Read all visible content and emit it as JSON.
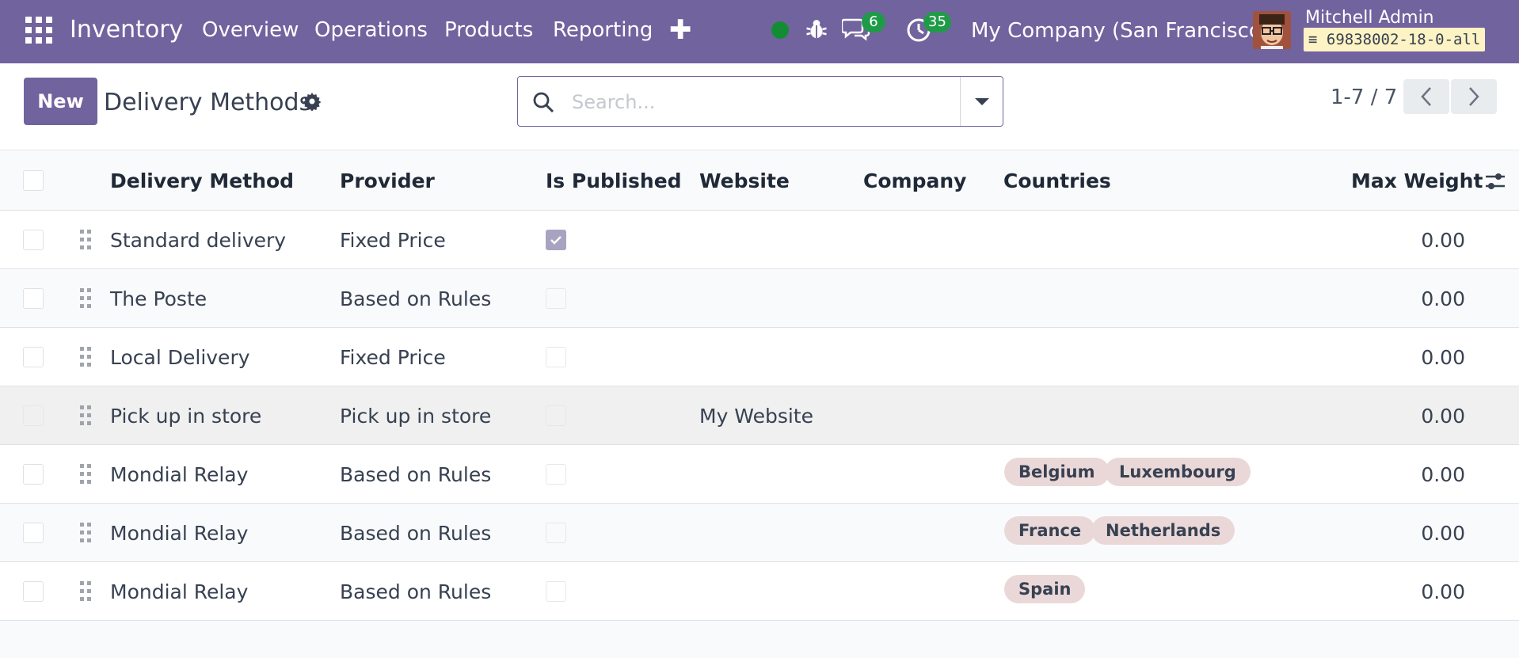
{
  "navbar": {
    "brand": "Inventory",
    "menu": [
      "Overview",
      "Operations",
      "Products",
      "Reporting"
    ],
    "chat_count": "6",
    "activity_count": "35",
    "company": "My Company (San Francisco)",
    "user_name": "Mitchell Admin",
    "db_name": "69838002-18-0-all",
    "brand_color": "#71639e"
  },
  "control": {
    "new_label": "New",
    "title": "Delivery Methods",
    "search_placeholder": "Search...",
    "pager": "1-7 / 7"
  },
  "columns": [
    "Delivery Method",
    "Provider",
    "Is Published",
    "Website",
    "Company",
    "Countries",
    "Max Weight"
  ],
  "rows": [
    {
      "method": "Standard delivery",
      "provider": "Fixed Price",
      "published": true,
      "website": "",
      "company": "",
      "countries": [],
      "max_weight": "0.00"
    },
    {
      "method": "The Poste",
      "provider": "Based on Rules",
      "published": false,
      "website": "",
      "company": "",
      "countries": [],
      "max_weight": "0.00"
    },
    {
      "method": "Local Delivery",
      "provider": "Fixed Price",
      "published": false,
      "website": "",
      "company": "",
      "countries": [],
      "max_weight": "0.00"
    },
    {
      "method": "Pick up in store",
      "provider": "Pick up in store",
      "published": false,
      "website": "My Website",
      "company": "",
      "countries": [],
      "max_weight": "0.00"
    },
    {
      "method": "Mondial Relay",
      "provider": "Based on Rules",
      "published": false,
      "website": "",
      "company": "",
      "countries": [
        "Belgium",
        "Luxembourg"
      ],
      "max_weight": "0.00"
    },
    {
      "method": "Mondial Relay",
      "provider": "Based on Rules",
      "published": false,
      "website": "",
      "company": "",
      "countries": [
        "France",
        "Netherlands"
      ],
      "max_weight": "0.00"
    },
    {
      "method": "Mondial Relay",
      "provider": "Based on Rules",
      "published": false,
      "website": "",
      "company": "",
      "countries": [
        "Spain"
      ],
      "max_weight": "0.00"
    }
  ]
}
